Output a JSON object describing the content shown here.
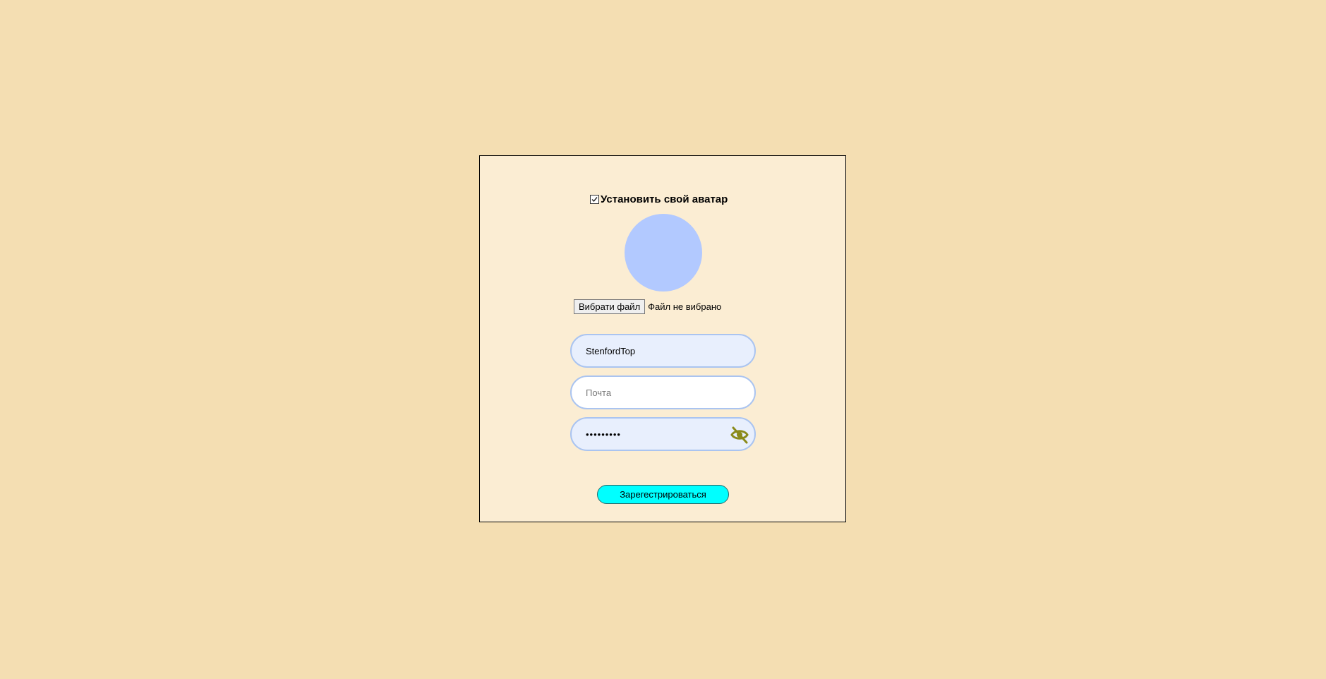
{
  "avatar_section": {
    "toggle_label": "Установить свой аватар",
    "toggle_checked": true,
    "avatar_color": "#b2c9ff",
    "file_button_label": "Вибрати файл",
    "file_status": "Файл не вибрано"
  },
  "form": {
    "username_value": "StenfordTop",
    "email_placeholder": "Почта",
    "password_masked": "•••••••••",
    "password_visibility_icon": "eye-off-icon",
    "submit_label": "Зарегестрироваться"
  },
  "colors": {
    "page_background": "#f4deb2",
    "card_background": "#fbedd3",
    "submit_background": "#00ffff",
    "eye_icon": "#8a8a1a",
    "field_border": "#aac4f0"
  }
}
